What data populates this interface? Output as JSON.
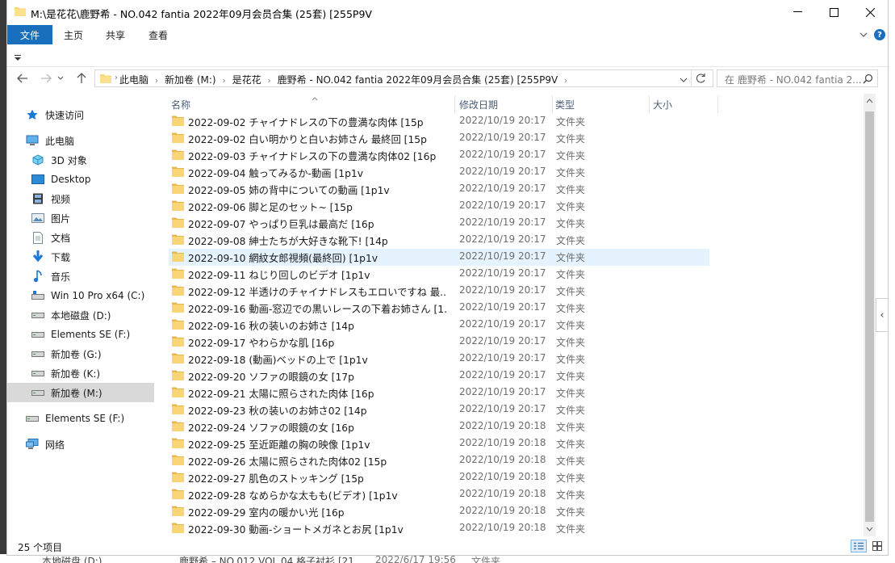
{
  "window": {
    "title": "M:\\是花花\\鹿野希 - NO.042 fantia 2022年09月会员合集 (25套) [255P9V",
    "minimize": "—",
    "maximize": "☐",
    "close": "✕"
  },
  "ribbon": {
    "file": "文件",
    "home": "主页",
    "share": "共享",
    "view": "查看"
  },
  "address": {
    "crumbs": [
      "此电脑",
      "新加卷 (M:)",
      "是花花",
      "鹿野希 - NO.042 fantia 2022年09月会员合集 (25套) [255P9V"
    ],
    "search_placeholder": "在 鹿野希 - NO.042 fantia 2..."
  },
  "sidebar": {
    "items": [
      {
        "label": "快速访问",
        "icon": "star-icon"
      },
      {
        "label": "此电脑",
        "icon": "computer-icon"
      },
      {
        "label": "3D 对象",
        "icon": "cube-icon"
      },
      {
        "label": "Desktop",
        "icon": "desktop-icon"
      },
      {
        "label": "视频",
        "icon": "video-icon"
      },
      {
        "label": "图片",
        "icon": "picture-icon"
      },
      {
        "label": "文档",
        "icon": "document-icon"
      },
      {
        "label": "下载",
        "icon": "download-icon"
      },
      {
        "label": "音乐",
        "icon": "music-icon"
      },
      {
        "label": "Win 10 Pro x64 (C:)",
        "icon": "drive-icon"
      },
      {
        "label": "本地磁盘 (D:)",
        "icon": "drive-icon"
      },
      {
        "label": "Elements SE (F:)",
        "icon": "drive-icon"
      },
      {
        "label": "新加卷 (G:)",
        "icon": "drive-icon"
      },
      {
        "label": "新加卷 (K:)",
        "icon": "drive-icon"
      },
      {
        "label": "新加卷 (M:)",
        "icon": "drive-icon"
      },
      {
        "label": "Elements SE (F:)",
        "icon": "drive-icon"
      },
      {
        "label": "网络",
        "icon": "network-icon"
      }
    ]
  },
  "columns": {
    "name": "名称",
    "modified": "修改日期",
    "type": "类型",
    "size": "大小"
  },
  "files": [
    {
      "name": "2022-09-02 チャイナドレスの下の豊満な肉体 [15p",
      "date": "2022/10/19 20:17",
      "type": "文件夹"
    },
    {
      "name": "2022-09-02 白い明かりと白いお姉さん 最終回 [15p",
      "date": "2022/10/19 20:17",
      "type": "文件夹"
    },
    {
      "name": "2022-09-03 チャイナドレスの下の豊満な肉体02 [16p",
      "date": "2022/10/19 20:17",
      "type": "文件夹"
    },
    {
      "name": "2022-09-04 触ってみるか-動画 [1p1v",
      "date": "2022/10/19 20:17",
      "type": "文件夹"
    },
    {
      "name": "2022-09-05 姉の背中についての動画 [1p1v",
      "date": "2022/10/19 20:17",
      "type": "文件夹"
    },
    {
      "name": "2022-09-06 脚と足のセット~ [15p",
      "date": "2022/10/19 20:17",
      "type": "文件夹"
    },
    {
      "name": "2022-09-07 やっぱり巨乳は最高だ [16p",
      "date": "2022/10/19 20:17",
      "type": "文件夹"
    },
    {
      "name": "2022-09-08 紳士たちが大好きな靴下! [14p",
      "date": "2022/10/19 20:17",
      "type": "文件夹"
    },
    {
      "name": "2022-09-10 網紋女郎視頻(最終回) [1p1v",
      "date": "2022/10/19 20:17",
      "type": "文件夹"
    },
    {
      "name": "2022-09-11 ねじり回しのビデオ [1p1v",
      "date": "2022/10/19 20:17",
      "type": "文件夹"
    },
    {
      "name": "2022-09-12 半透けのチャイナドレスもエロいですね 最...",
      "date": "2022/10/19 20:17",
      "type": "文件夹"
    },
    {
      "name": "2022-09-16 動画-窓辺での黒いレースの下着お姉さん [1...",
      "date": "2022/10/19 20:17",
      "type": "文件夹"
    },
    {
      "name": "2022-09-16 秋の装いのお姉さ [14p",
      "date": "2022/10/19 20:17",
      "type": "文件夹"
    },
    {
      "name": "2022-09-17 やわらかな肌 [16p",
      "date": "2022/10/19 20:17",
      "type": "文件夹"
    },
    {
      "name": "2022-09-18 (動画)ベッドの上で [1p1v",
      "date": "2022/10/19 20:17",
      "type": "文件夹"
    },
    {
      "name": "2022-09-20 ソファの眼鏡の女 [17p",
      "date": "2022/10/19 20:17",
      "type": "文件夹"
    },
    {
      "name": "2022-09-21 太陽に照らされた肉体 [16p",
      "date": "2022/10/19 20:17",
      "type": "文件夹"
    },
    {
      "name": "2022-09-23 秋の装いのお姉さ02 [14p",
      "date": "2022/10/19 20:17",
      "type": "文件夹"
    },
    {
      "name": "2022-09-24 ソファの眼鏡の女 [16p",
      "date": "2022/10/19 20:18",
      "type": "文件夹"
    },
    {
      "name": "2022-09-25 至近距離の胸の映像 [1p1v",
      "date": "2022/10/19 20:18",
      "type": "文件夹"
    },
    {
      "name": "2022-09-26 太陽に照らされた肉体02 [15p",
      "date": "2022/10/19 20:18",
      "type": "文件夹"
    },
    {
      "name": "2022-09-27 肌色のストッキング [15p",
      "date": "2022/10/19 20:18",
      "type": "文件夹"
    },
    {
      "name": "2022-09-28 なめらかな太もも(ビデオ) [1p1v",
      "date": "2022/10/19 20:18",
      "type": "文件夹"
    },
    {
      "name": "2022-09-29 室内の暖かい光 [16p",
      "date": "2022/10/19 20:18",
      "type": "文件夹"
    },
    {
      "name": "2022-09-30 動画-ショートメガネとお尻 [1p1v",
      "date": "2022/10/19 20:18",
      "type": "文件夹"
    }
  ],
  "status": {
    "count": "25 个项目"
  },
  "background": {
    "ghost_left": "本地磁盘 (D:)",
    "ghost_name": "鹿野希 – NO.012 VOL.04 格子衬衫 [21",
    "ghost_date": "2022/6/17 19:56",
    "ghost_type": "文件夹"
  },
  "colors": {
    "accent": "#1a6fbd",
    "folder": "#f8d675",
    "hover": "#e5f3ff",
    "selected_nav": "#d9d9d9"
  }
}
